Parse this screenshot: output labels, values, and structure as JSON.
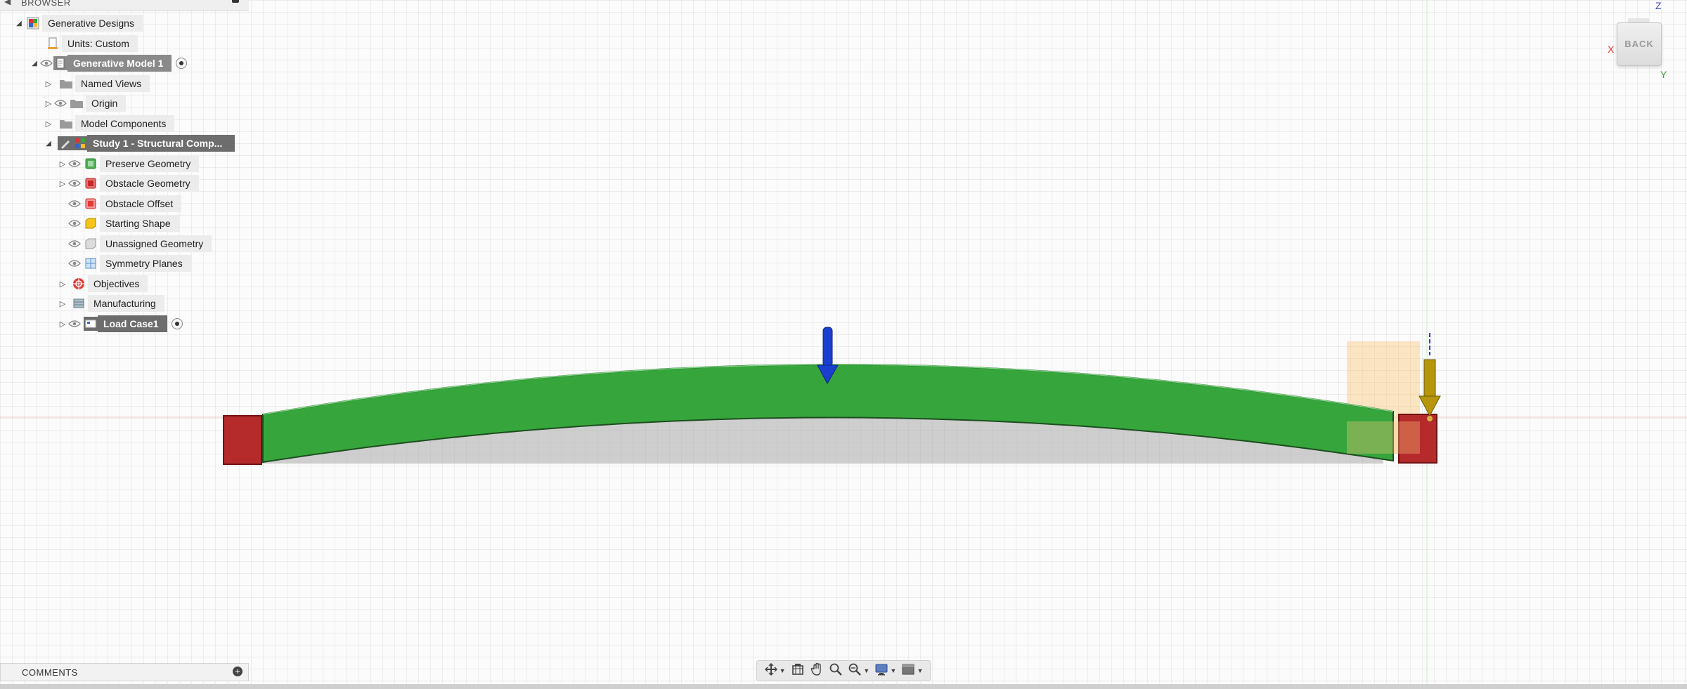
{
  "browser": {
    "title": "BROWSER",
    "root": "Generative Designs",
    "units": "Units: Custom",
    "model": "Generative Model 1",
    "named_views": "Named Views",
    "origin": "Origin",
    "model_components": "Model Components",
    "study": "Study 1 - Structural Comp...",
    "preserve": "Preserve Geometry",
    "obstacle": "Obstacle Geometry",
    "obstacle_offset": "Obstacle Offset",
    "starting_shape": "Starting Shape",
    "unassigned": "Unassigned Geometry",
    "symmetry": "Symmetry Planes",
    "objectives": "Objectives",
    "manufacturing": "Manufacturing",
    "load_case": "Load Case1"
  },
  "comments": {
    "title": "COMMENTS"
  },
  "viewcube": {
    "face": "BACK",
    "x_label": "X",
    "y_label": "Y",
    "z_label": "Z"
  },
  "nav_toolbar": {
    "tools": [
      "orbit-icon",
      "look-at-icon",
      "pan-icon",
      "zoom-icon",
      "zoom-window-icon",
      "display-settings-icon",
      "visual-style-icon"
    ]
  },
  "colors": {
    "preserve_red": "#b52a2a",
    "beam_green": "#36a63c",
    "load_blue": "#1a3fcf",
    "load_gold": "#b8960c",
    "starting_shape": "#f6c87a",
    "selection_dark": "#6d6d6d"
  }
}
